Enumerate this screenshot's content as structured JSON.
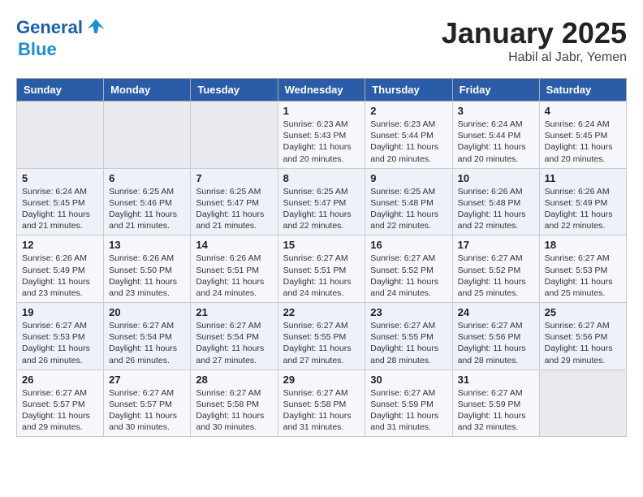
{
  "header": {
    "logo_line1": "General",
    "logo_line2": "Blue",
    "month": "January 2025",
    "location": "Habil al Jabr, Yemen"
  },
  "days_of_week": [
    "Sunday",
    "Monday",
    "Tuesday",
    "Wednesday",
    "Thursday",
    "Friday",
    "Saturday"
  ],
  "weeks": [
    [
      {
        "day": "",
        "content": ""
      },
      {
        "day": "",
        "content": ""
      },
      {
        "day": "",
        "content": ""
      },
      {
        "day": "1",
        "content": "Sunrise: 6:23 AM\nSunset: 5:43 PM\nDaylight: 11 hours and 20 minutes."
      },
      {
        "day": "2",
        "content": "Sunrise: 6:23 AM\nSunset: 5:44 PM\nDaylight: 11 hours and 20 minutes."
      },
      {
        "day": "3",
        "content": "Sunrise: 6:24 AM\nSunset: 5:44 PM\nDaylight: 11 hours and 20 minutes."
      },
      {
        "day": "4",
        "content": "Sunrise: 6:24 AM\nSunset: 5:45 PM\nDaylight: 11 hours and 20 minutes."
      }
    ],
    [
      {
        "day": "5",
        "content": "Sunrise: 6:24 AM\nSunset: 5:45 PM\nDaylight: 11 hours and 21 minutes."
      },
      {
        "day": "6",
        "content": "Sunrise: 6:25 AM\nSunset: 5:46 PM\nDaylight: 11 hours and 21 minutes."
      },
      {
        "day": "7",
        "content": "Sunrise: 6:25 AM\nSunset: 5:47 PM\nDaylight: 11 hours and 21 minutes."
      },
      {
        "day": "8",
        "content": "Sunrise: 6:25 AM\nSunset: 5:47 PM\nDaylight: 11 hours and 22 minutes."
      },
      {
        "day": "9",
        "content": "Sunrise: 6:25 AM\nSunset: 5:48 PM\nDaylight: 11 hours and 22 minutes."
      },
      {
        "day": "10",
        "content": "Sunrise: 6:26 AM\nSunset: 5:48 PM\nDaylight: 11 hours and 22 minutes."
      },
      {
        "day": "11",
        "content": "Sunrise: 6:26 AM\nSunset: 5:49 PM\nDaylight: 11 hours and 22 minutes."
      }
    ],
    [
      {
        "day": "12",
        "content": "Sunrise: 6:26 AM\nSunset: 5:49 PM\nDaylight: 11 hours and 23 minutes."
      },
      {
        "day": "13",
        "content": "Sunrise: 6:26 AM\nSunset: 5:50 PM\nDaylight: 11 hours and 23 minutes."
      },
      {
        "day": "14",
        "content": "Sunrise: 6:26 AM\nSunset: 5:51 PM\nDaylight: 11 hours and 24 minutes."
      },
      {
        "day": "15",
        "content": "Sunrise: 6:27 AM\nSunset: 5:51 PM\nDaylight: 11 hours and 24 minutes."
      },
      {
        "day": "16",
        "content": "Sunrise: 6:27 AM\nSunset: 5:52 PM\nDaylight: 11 hours and 24 minutes."
      },
      {
        "day": "17",
        "content": "Sunrise: 6:27 AM\nSunset: 5:52 PM\nDaylight: 11 hours and 25 minutes."
      },
      {
        "day": "18",
        "content": "Sunrise: 6:27 AM\nSunset: 5:53 PM\nDaylight: 11 hours and 25 minutes."
      }
    ],
    [
      {
        "day": "19",
        "content": "Sunrise: 6:27 AM\nSunset: 5:53 PM\nDaylight: 11 hours and 26 minutes."
      },
      {
        "day": "20",
        "content": "Sunrise: 6:27 AM\nSunset: 5:54 PM\nDaylight: 11 hours and 26 minutes."
      },
      {
        "day": "21",
        "content": "Sunrise: 6:27 AM\nSunset: 5:54 PM\nDaylight: 11 hours and 27 minutes."
      },
      {
        "day": "22",
        "content": "Sunrise: 6:27 AM\nSunset: 5:55 PM\nDaylight: 11 hours and 27 minutes."
      },
      {
        "day": "23",
        "content": "Sunrise: 6:27 AM\nSunset: 5:55 PM\nDaylight: 11 hours and 28 minutes."
      },
      {
        "day": "24",
        "content": "Sunrise: 6:27 AM\nSunset: 5:56 PM\nDaylight: 11 hours and 28 minutes."
      },
      {
        "day": "25",
        "content": "Sunrise: 6:27 AM\nSunset: 5:56 PM\nDaylight: 11 hours and 29 minutes."
      }
    ],
    [
      {
        "day": "26",
        "content": "Sunrise: 6:27 AM\nSunset: 5:57 PM\nDaylight: 11 hours and 29 minutes."
      },
      {
        "day": "27",
        "content": "Sunrise: 6:27 AM\nSunset: 5:57 PM\nDaylight: 11 hours and 30 minutes."
      },
      {
        "day": "28",
        "content": "Sunrise: 6:27 AM\nSunset: 5:58 PM\nDaylight: 11 hours and 30 minutes."
      },
      {
        "day": "29",
        "content": "Sunrise: 6:27 AM\nSunset: 5:58 PM\nDaylight: 11 hours and 31 minutes."
      },
      {
        "day": "30",
        "content": "Sunrise: 6:27 AM\nSunset: 5:59 PM\nDaylight: 11 hours and 31 minutes."
      },
      {
        "day": "31",
        "content": "Sunrise: 6:27 AM\nSunset: 5:59 PM\nDaylight: 11 hours and 32 minutes."
      },
      {
        "day": "",
        "content": ""
      }
    ]
  ]
}
